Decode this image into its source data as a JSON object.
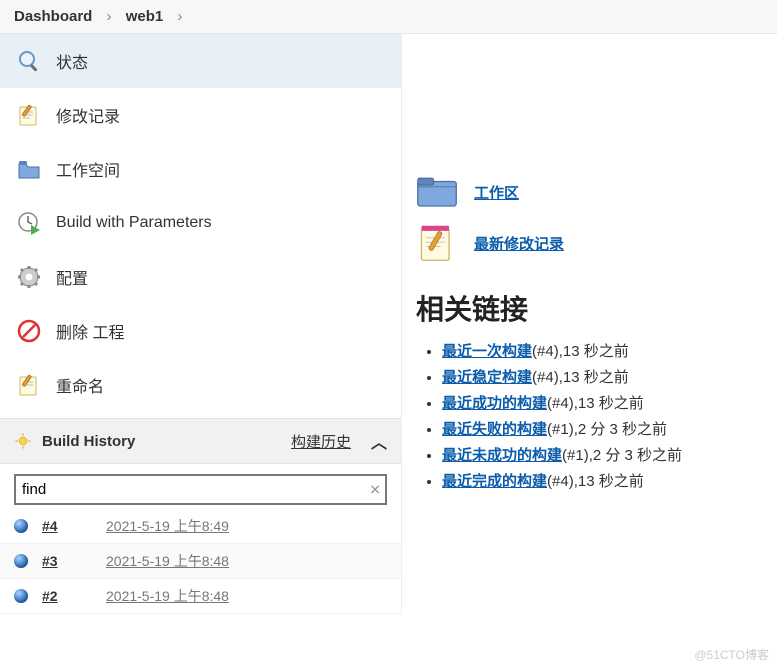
{
  "breadcrumb": {
    "items": [
      "Dashboard",
      "web1"
    ]
  },
  "sidebar": {
    "items": [
      {
        "label": "状态",
        "icon": "search-icon",
        "selected": true
      },
      {
        "label": "修改记录",
        "icon": "notepad-icon",
        "selected": false
      },
      {
        "label": "工作空间",
        "icon": "folder-icon",
        "selected": false
      },
      {
        "label": "Build with Parameters",
        "icon": "clock-play-icon",
        "selected": false
      },
      {
        "label": "配置",
        "icon": "gear-icon",
        "selected": false
      },
      {
        "label": "删除 工程",
        "icon": "delete-icon",
        "selected": false
      },
      {
        "label": "重命名",
        "icon": "rename-icon",
        "selected": false
      }
    ]
  },
  "buildHistory": {
    "title": "Build History",
    "trendLabel": "构建历史",
    "search": {
      "placeholder": "",
      "value": "find"
    },
    "builds": [
      {
        "num": "#4",
        "time": "2021-5-19 上午8:49",
        "status": "blue"
      },
      {
        "num": "#3",
        "time": "2021-5-19 上午8:48",
        "status": "blue"
      },
      {
        "num": "#2",
        "time": "2021-5-19 上午8:48",
        "status": "blue"
      }
    ]
  },
  "main": {
    "quickLinks": [
      {
        "label": "工作区",
        "icon": "folder-large-icon"
      },
      {
        "label": "最新修改记录",
        "icon": "notepad-large-icon"
      }
    ],
    "relatedHeading": "相关链接",
    "related": [
      {
        "link": "最近一次构建",
        "meta": "(#4),13 秒之前"
      },
      {
        "link": "最近稳定构建",
        "meta": "(#4),13 秒之前"
      },
      {
        "link": "最近成功的构建",
        "meta": "(#4),13 秒之前"
      },
      {
        "link": "最近失败的构建",
        "meta": "(#1),2 分 3 秒之前"
      },
      {
        "link": "最近未成功的构建",
        "meta": "(#1),2 分 3 秒之前"
      },
      {
        "link": "最近完成的构建",
        "meta": "(#4),13 秒之前"
      }
    ]
  },
  "watermark": "@51CTO博客"
}
